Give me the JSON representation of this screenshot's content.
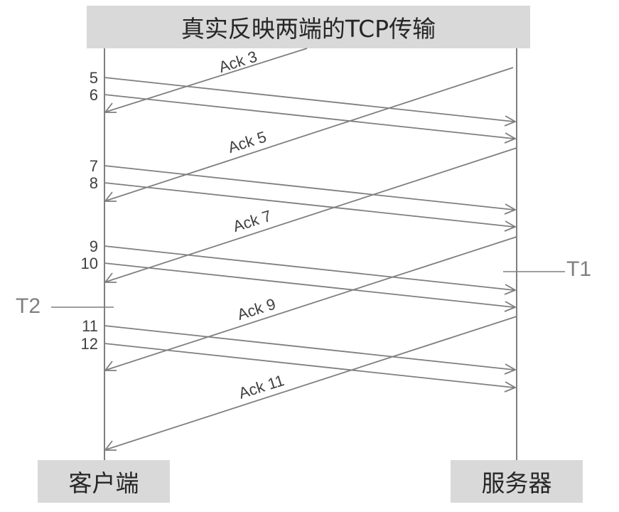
{
  "title": "真实反映两端的TCP传输",
  "client_label": "客户端",
  "server_label": "服务器",
  "marker_t1": "T1",
  "marker_t2": "T2",
  "colors": {
    "line": "#7f7f7f",
    "box": "#d9d9d9",
    "text": "#404040"
  },
  "segments": [
    {
      "label": "5"
    },
    {
      "label": "6"
    },
    {
      "label": "7"
    },
    {
      "label": "8"
    },
    {
      "label": "9"
    },
    {
      "label": "10"
    },
    {
      "label": "11"
    },
    {
      "label": "12"
    }
  ],
  "acks": [
    {
      "label": "Ack 3"
    },
    {
      "label": "Ack 5"
    },
    {
      "label": "Ack 7"
    },
    {
      "label": "Ack 9"
    },
    {
      "label": "Ack 11"
    }
  ]
}
